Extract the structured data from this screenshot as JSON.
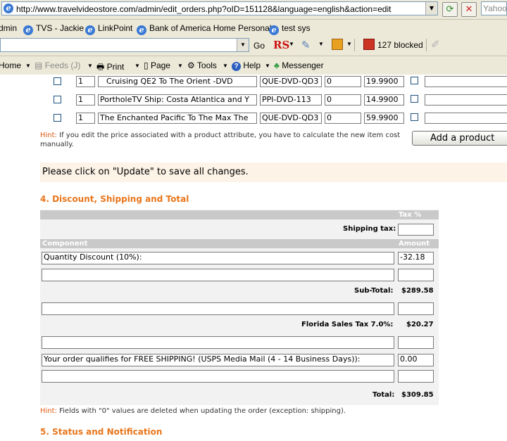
{
  "browser": {
    "url": "http://www.travelvideostore.com/admin/edit_orders.php?oID=151128&language=english&action=edit",
    "search_placeholder": "Yahoo!",
    "links": [
      "dmin",
      "TVS - Jackie",
      "LinkPoint",
      "Bank of America  Home  Personal",
      "test sys"
    ],
    "search_go": "Go",
    "popups_blocked": "127 blocked",
    "commands": {
      "home": "Home",
      "feeds": "Feeds (J)",
      "print": "Print",
      "page": "Page",
      "tools": "Tools",
      "help": "Help",
      "messenger": "Messenger"
    }
  },
  "products": [
    {
      "qty": "1",
      "name": "Cruising QE2 To The Orient -DVD",
      "model": "QUE-DVD-QD3",
      "tax": "0",
      "price": "19.9900"
    },
    {
      "qty": "1",
      "name": "PortholeTV Ship: Costa Atlantica and Y",
      "model": "PPI-DVD-113",
      "tax": "0",
      "price": "14.9900"
    },
    {
      "qty": "1",
      "name": "The Enchanted Pacific To The Max The",
      "model": "QUE-DVD-QD3",
      "tax": "0",
      "price": "59.9900"
    }
  ],
  "hint1": {
    "label": "Hint:",
    "text": "If you edit the price associated with a product attribute, you have to calculate the new item cost manually."
  },
  "add_product_label": "Add a product",
  "update_message": "Please click on \"Update\" to save all changes.",
  "section4_title": "4. Discount, Shipping and Total",
  "totals": {
    "tax_header": "Tax %",
    "shipping_tax_label": "Shipping tax:",
    "shipping_tax_value": "",
    "component_header": "Component",
    "amount_header": "Amount",
    "discount_title": "Quantity Discount (10%):",
    "discount_value": "-32.18",
    "subtotal_label": "Sub-Total:",
    "subtotal_value": "$289.58",
    "tax_label": "Florida Sales Tax 7.0%:",
    "tax_value": "$20.27",
    "shipping_title": "Your order qualifies for FREE SHIPPING! (USPS Media Mail (4 - 14 Business Days)):",
    "shipping_value": "0.00",
    "total_label": "Total:",
    "total_value": "$309.85"
  },
  "hint2": {
    "label": "Hint:",
    "text": "Fields with \"0\" values are deleted when updating the order (exception: shipping)."
  },
  "section5_title": "5. Status and Notification",
  "colors": {
    "accent": "#e8761c",
    "hint": "#e05a10",
    "panel": "#f2f2f2",
    "panel_header": "#c9c9c9",
    "notice_bg": "#fdf3e6"
  }
}
